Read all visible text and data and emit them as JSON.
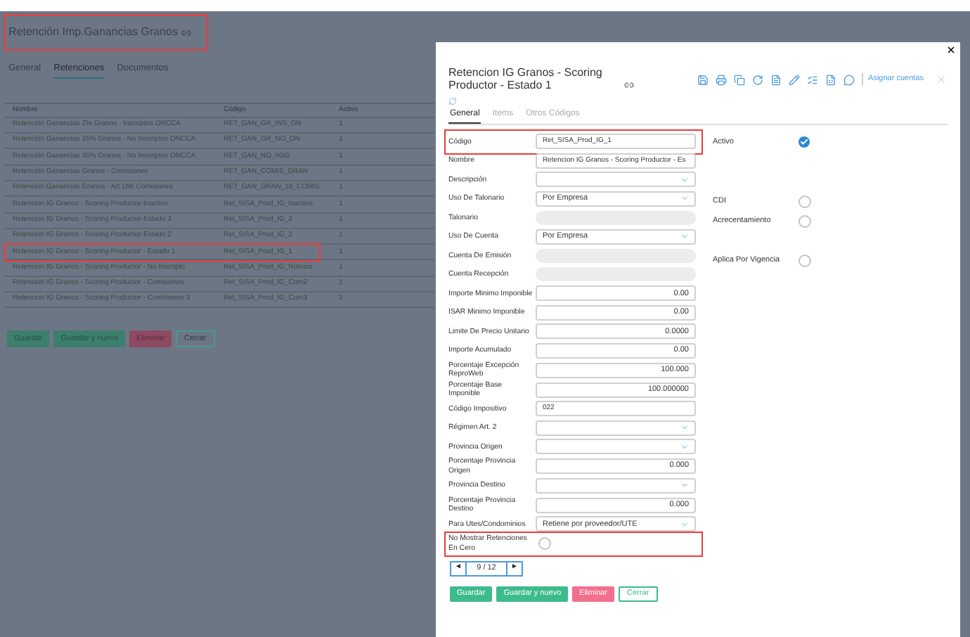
{
  "page": {
    "title": "Retención Imp.Ganancias Granos",
    "title_highlighted": true,
    "tabs": [
      {
        "label": "General",
        "selected": false
      },
      {
        "label": "Retenciones",
        "selected": true
      },
      {
        "label": "Documentos",
        "selected": false
      }
    ],
    "table": {
      "columns": [
        "Nombre",
        "Código",
        "Activo"
      ],
      "rows": [
        {
          "cells": [
            "Retención Ganancias 2% Granos - Inscriptos ONCCA",
            "RET_GAN_GR_INS_ON",
            "1"
          ],
          "highlighted": false
        },
        {
          "cells": [
            "Retención Ganancias 15% Granos - No Inscriptos ONCCA",
            "RET_GAN_GR_NO_ON",
            "1"
          ],
          "highlighted": false
        },
        {
          "cells": [
            "Retención Ganancias 35% Granos - No Inscriptos ONCCA",
            "RET_GAN_NO_IIGG",
            "1"
          ],
          "highlighted": false
        },
        {
          "cells": [
            "Retención Ganancias Granos - Comisiones",
            "RET_GAN_COMIS_GRAN",
            "1"
          ],
          "highlighted": false
        },
        {
          "cells": [
            "Retención Ganancias Granos - Art 16K Comisiones",
            "RET_GAN_GRAN_16_COMIS",
            "1"
          ],
          "highlighted": false
        },
        {
          "cells": [
            "Retencion IG Granos - Scoring Productor-Inactivo",
            "Ret_SISA_Prod_IG_Inactivo",
            "1"
          ],
          "highlighted": false
        },
        {
          "cells": [
            "Retencion IG Granos - Scoring Productor-Estado 3",
            "Ret_SISA_Prod_IG_3",
            "1"
          ],
          "highlighted": false
        },
        {
          "cells": [
            "Retencion IG Granos - Scoring Productor-Estado 2",
            "Ret_SISA_Prod_IG_2",
            "1"
          ],
          "highlighted": false
        },
        {
          "cells": [
            "Retencion IG Granos - Scoring Productor - Estado 1",
            "Ret_SISA_Prod_IG_1",
            "1"
          ],
          "highlighted": true
        },
        {
          "cells": [
            "Retencion IG Granos - Scoring Productor - No Inscripto",
            "Ret_SISA_Prod_IG_NoInscr",
            "1"
          ],
          "highlighted": false
        },
        {
          "cells": [
            "Retencion IG Granos - Scoring Productor - Comisiones",
            "Ret_SISA_Prod_IG_Com2",
            "1"
          ],
          "highlighted": false
        },
        {
          "cells": [
            "Retencion IG Granos - Scoring Productor - Comisiones 3",
            "Ret_SISA_Prod_IG_Com3",
            "1"
          ],
          "highlighted": false
        }
      ]
    },
    "buttons": [
      {
        "label": "Guardar",
        "kind": "primary"
      },
      {
        "label": "Guardar y nuevo",
        "kind": "primary"
      },
      {
        "label": "Eliminar",
        "kind": "danger"
      },
      {
        "label": "Cerrar",
        "kind": "outline"
      }
    ]
  },
  "modal": {
    "title": "Retencion IG Granos - Scoring Productor - Estado 1",
    "toolbar_link": "Asignar cuentas",
    "tabs": [
      {
        "label": "General",
        "selected": true
      },
      {
        "label": "Items",
        "selected": false
      },
      {
        "label": "Otros Códigos",
        "selected": false
      }
    ],
    "fields": [
      {
        "label": "Código",
        "kind": "text",
        "value": "Ret_SISA_Prod_IG_1",
        "highlighted": true
      },
      {
        "label": "Nombre",
        "kind": "text",
        "value": "Retencion IG Granos - Scoring Productor - Es",
        "highlighted": false
      },
      {
        "label": "Descripción",
        "kind": "select",
        "highlighted": false
      },
      {
        "label": "Uso De Talonario",
        "kind": "select",
        "value": "Por Empresa",
        "highlighted": false
      },
      {
        "label": "Talonario",
        "kind": "disabled",
        "highlighted": false
      },
      {
        "label": "Uso De Cuenta",
        "kind": "select",
        "value": "Por Empresa",
        "highlighted": false
      },
      {
        "label": "Cuenta De Emisión",
        "kind": "disabled",
        "highlighted": false
      },
      {
        "label": "Cuenta Recepción",
        "kind": "disabled",
        "highlighted": false
      },
      {
        "label": "Importe Minimo Imponible",
        "kind": "number",
        "value": "0.00",
        "highlighted": false
      },
      {
        "label": "ISAR Minimo Imponible",
        "kind": "number",
        "value": "0.00",
        "highlighted": false
      },
      {
        "label": "Limite De Precio Unitario",
        "kind": "number",
        "value": "0.0000",
        "highlighted": false
      },
      {
        "label": "Importe Acumulado",
        "kind": "number",
        "value": "0.00",
        "highlighted": false
      },
      {
        "label": "Porcentaje Excepción ReproWeb",
        "kind": "number",
        "value": "100.000",
        "highlighted": false
      },
      {
        "label": "Porcentaje Base Imponible",
        "kind": "number",
        "value": "100.000000",
        "highlighted": false
      },
      {
        "label": "Código Impositivo",
        "kind": "text",
        "value": "022",
        "highlighted": false
      },
      {
        "label": "Régimen Art. 2",
        "kind": "select",
        "highlighted": false
      },
      {
        "label": "Provincia Origen",
        "kind": "select",
        "highlighted": false
      },
      {
        "label": "Porcentaje Provincia Origen",
        "kind": "number",
        "value": "0.000",
        "highlighted": false
      },
      {
        "label": "Provincia Destino",
        "kind": "select",
        "highlighted": false
      },
      {
        "label": "Porcentaje Provincia Destino",
        "kind": "number",
        "value": "0.000",
        "highlighted": false
      },
      {
        "label": "Para Utes/Condominios",
        "kind": "select",
        "value": "Retiene por proveedor/UTE",
        "highlighted": false
      },
      {
        "label": "No Mostrar Retenciones En Cero",
        "kind": "radio",
        "checked": false,
        "highlighted": true
      }
    ],
    "side_fields": [
      {
        "label": "Activo",
        "kind": "checkbox",
        "checked": true
      },
      {
        "label": "CDI",
        "kind": "radio",
        "checked": false
      },
      {
        "label": "Acrecentamiento",
        "kind": "radio",
        "checked": false
      },
      {
        "label": "Aplica Por Vigencia",
        "kind": "radio",
        "checked": false
      }
    ],
    "pager": {
      "prev": "◄",
      "position": "9 / 12",
      "next": "►"
    },
    "buttons": [
      {
        "label": "Guardar",
        "kind": "primary"
      },
      {
        "label": "Guardar y nuevo",
        "kind": "primary"
      },
      {
        "label": "Eliminar",
        "kind": "danger"
      },
      {
        "label": "Cerrar",
        "kind": "outline"
      }
    ]
  }
}
